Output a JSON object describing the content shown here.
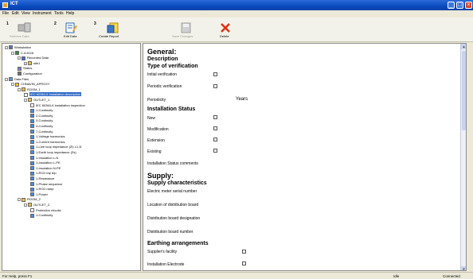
{
  "window": {
    "title": "ICT"
  },
  "menu": [
    "File",
    "Edit",
    "View",
    "Instrument",
    "Tools",
    "Help"
  ],
  "toolbar": {
    "groups": [
      {
        "num": "1",
        "label": "Retrieve Data",
        "enabled": false
      },
      {
        "num": "2",
        "label": "Edit Data",
        "enabled": true
      },
      {
        "num": "3",
        "label": "Create Report",
        "enabled": true
      },
      {
        "num": "",
        "label": "Save Changes",
        "enabled": false
      },
      {
        "num": "",
        "label": "Delete",
        "enabled": true
      }
    ]
  },
  "tree": [
    {
      "label": "Workstation",
      "level": 0,
      "icon": "computer-icon",
      "expander": "-"
    },
    {
      "label": "C.A 6116",
      "level": 1,
      "icon": "instrument-icon",
      "expander": "-"
    },
    {
      "label": "Recorded Data",
      "level": 2,
      "icon": "recorded-data-icon",
      "expander": "-"
    },
    {
      "label": "site1",
      "level": 3,
      "icon": "folder-icon",
      "expander": "+"
    },
    {
      "label": "Status",
      "level": 2,
      "icon": "status-icon",
      "expander": ""
    },
    {
      "label": "Configuration",
      "level": 2,
      "icon": "configuration-icon",
      "expander": ""
    },
    {
      "label": "Data Files",
      "level": 0,
      "icon": "data-files-icon",
      "expander": "-"
    },
    {
      "label": "CHNAVIN_APROXY",
      "level": 1,
      "icon": "folder-icon",
      "expander": "-"
    },
    {
      "label": "ROOM_1",
      "level": 2,
      "icon": "folder-icon",
      "expander": "-"
    },
    {
      "label": "IEC 60364-6 Installation description",
      "level": 3,
      "icon": "document-icon",
      "expander": "",
      "selected": true
    },
    {
      "label": "OUTLET_1",
      "level": 3,
      "icon": "folder-icon",
      "expander": "-"
    },
    {
      "label": "IEC 60364-6 Installation inspection",
      "level": 4,
      "icon": "document-icon",
      "expander": ""
    },
    {
      "label": "1-Continuity",
      "level": 4,
      "icon": "measure-icon",
      "expander": ""
    },
    {
      "label": "2-Continuity",
      "level": 4,
      "icon": "measure-icon",
      "expander": ""
    },
    {
      "label": "3-Continuity",
      "level": 4,
      "icon": "measure-icon",
      "expander": ""
    },
    {
      "label": "4-Continuity",
      "level": 4,
      "icon": "measure-icon",
      "expander": ""
    },
    {
      "label": "7-Continuity",
      "level": 4,
      "icon": "measure-icon",
      "expander": ""
    },
    {
      "label": "1-Voltage harmonics",
      "level": 4,
      "icon": "measure-icon",
      "expander": ""
    },
    {
      "label": "1-Current harmonics",
      "level": 4,
      "icon": "measure-icon",
      "expander": ""
    },
    {
      "label": "1-Line loop impedance (Zl) L1-N",
      "level": 4,
      "icon": "measure-icon",
      "expander": ""
    },
    {
      "label": "1-Earth loop impedance (Zs)",
      "level": 4,
      "icon": "measure-icon",
      "expander": ""
    },
    {
      "label": "1-Insulation L-N",
      "level": 4,
      "icon": "measure-icon",
      "expander": ""
    },
    {
      "label": "1-Insulation L-PE",
      "level": 4,
      "icon": "measure-icon",
      "expander": ""
    },
    {
      "label": "1-Insulation N-PE",
      "level": 4,
      "icon": "measure-icon",
      "expander": ""
    },
    {
      "label": "1-RCD trip trip",
      "level": 4,
      "icon": "measure-icon",
      "expander": ""
    },
    {
      "label": "1-Resistance",
      "level": 4,
      "icon": "measure-icon",
      "expander": ""
    },
    {
      "label": "1-Phase sequence",
      "level": 4,
      "icon": "measure-icon",
      "expander": ""
    },
    {
      "label": "1-RCD ramp",
      "level": 4,
      "icon": "measure-icon",
      "expander": ""
    },
    {
      "label": "1-Power",
      "level": 4,
      "icon": "measure-icon",
      "expander": ""
    },
    {
      "label": "ROOM_2",
      "level": 2,
      "icon": "folder-icon",
      "expander": "-"
    },
    {
      "label": "OUTLET_2",
      "level": 3,
      "icon": "folder-icon",
      "expander": "-"
    },
    {
      "label": "Protection circuits",
      "level": 4,
      "icon": "document-icon",
      "expander": ""
    },
    {
      "label": "1-Continuity",
      "level": 4,
      "icon": "measure-icon",
      "expander": ""
    }
  ],
  "form": {
    "general_heading": "General:",
    "description_heading": "Description",
    "verification_heading": "Type of verification",
    "initial_verification": "Initial verification",
    "periodic_verification": "Periodic verification",
    "periodicity": "Periodicity",
    "periodicity_unit": "Years",
    "installation_status_heading": "Installation Status",
    "status_new": "New",
    "status_modification": "Modification",
    "status_extension": "Extension",
    "status_existing": "Existing",
    "status_comments": "Installation Status comments",
    "supply_heading": "Supply:",
    "supply_characteristics_heading": "Supply characteristics",
    "electric_meter": "Electric meter serial number",
    "distribution_board_location": "Location of distribution board",
    "distribution_board_designation": "Distribution board designation",
    "distribution_board_number": "Distribution board number",
    "earthing_heading": "Earthing arrangements",
    "suppliers_facility": "Supplier's facility",
    "installation_electrode": "Installation Electrode"
  },
  "status": {
    "help": "For Help, press F1",
    "state": "Idle",
    "connection": "Connected"
  }
}
